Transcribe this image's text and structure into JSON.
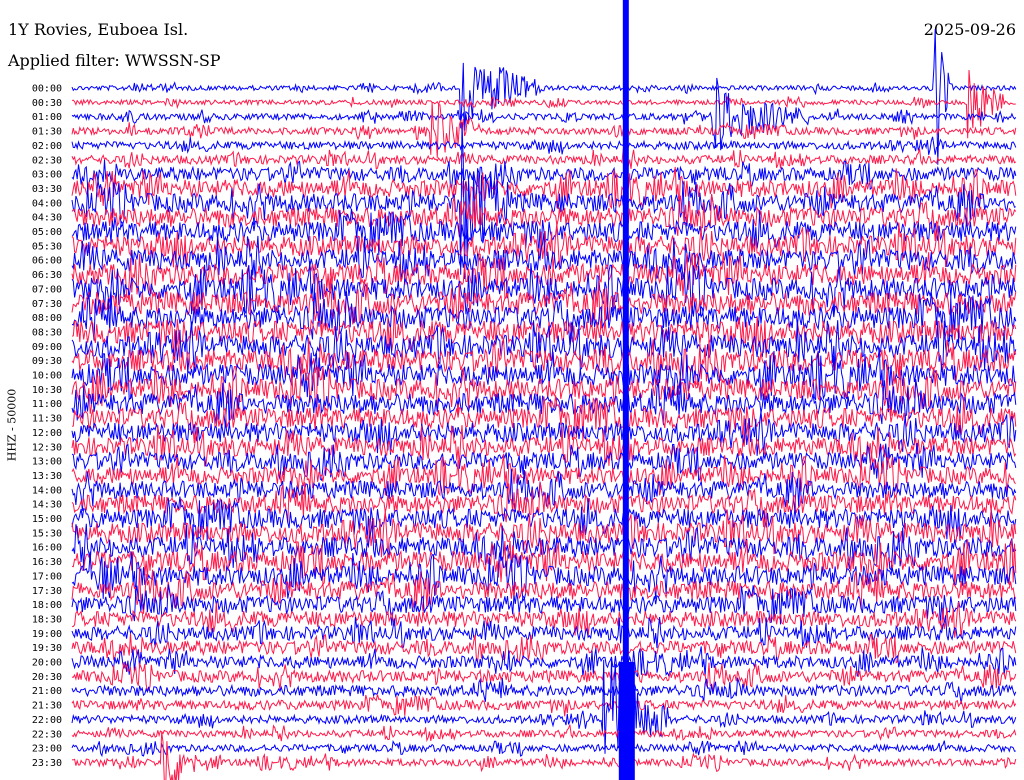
{
  "header": {
    "station": "1Y Rovies, Euboea Isl.",
    "date": "2025-09-26",
    "filter": "Applied filter: WWSSN-SP"
  },
  "colors": {
    "trace_a": "#0000ff",
    "trace_b": "#ff1a4a",
    "background": "#ffffff"
  },
  "chart_data": {
    "type": "line",
    "ylabel": "HHZ - 50000",
    "rows": [
      "00:00",
      "00:30",
      "01:00",
      "01:30",
      "02:00",
      "02:30",
      "03:00",
      "03:30",
      "04:00",
      "04:30",
      "05:00",
      "05:30",
      "06:00",
      "06:30",
      "07:00",
      "07:30",
      "08:00",
      "08:30",
      "09:00",
      "09:30",
      "10:00",
      "10:30",
      "11:00",
      "11:30",
      "12:00",
      "12:30",
      "13:00",
      "13:30",
      "14:00",
      "14:30",
      "15:00",
      "15:30",
      "16:00",
      "16:30",
      "17:00",
      "17:30",
      "18:00",
      "18:30",
      "19:00",
      "19:30",
      "20:00",
      "20:30",
      "21:00",
      "21:30",
      "22:00",
      "22:30",
      "23:00",
      "23:30"
    ],
    "noise_amplitude_by_row": [
      0.3,
      0.3,
      0.4,
      0.45,
      0.5,
      0.55,
      0.85,
      1.1,
      1.2,
      1.25,
      1.3,
      1.3,
      1.35,
      1.35,
      1.4,
      1.45,
      1.45,
      1.45,
      1.45,
      1.4,
      1.4,
      1.35,
      1.35,
      1.3,
      1.25,
      1.2,
      1.1,
      1.1,
      1.15,
      1.2,
      1.25,
      1.3,
      1.3,
      1.3,
      1.25,
      1.2,
      1.1,
      1.0,
      0.9,
      0.85,
      0.8,
      0.75,
      0.7,
      0.6,
      0.5,
      0.45,
      0.45,
      0.45
    ],
    "events": [
      {
        "row": 0,
        "minute": 12.5,
        "amplitude": 3.0,
        "duration_min": 2.5
      },
      {
        "row": 0,
        "minute": 27.5,
        "amplitude": 6.0,
        "duration_min": 0.4
      },
      {
        "row": 2,
        "minute": 20.5,
        "amplitude": 2.5,
        "duration_min": 3.0
      },
      {
        "row": 3,
        "minute": 11.5,
        "amplitude": 1.8,
        "duration_min": 1.5
      },
      {
        "row": 1,
        "minute": 28.6,
        "amplitude": 3.0,
        "duration_min": 1.0
      },
      {
        "row": 8,
        "minute": 12.5,
        "amplitude": 5.0,
        "duration_min": 1.5
      },
      {
        "row": 44,
        "minute": 17.0,
        "amplitude": 5.0,
        "duration_min": 2.0
      },
      {
        "row": 47,
        "minute": 3.0,
        "amplitude": 3.0,
        "duration_min": 1.0
      }
    ],
    "large_event": {
      "row_start": 0,
      "row_end": 47,
      "minute": 17.6
    }
  }
}
